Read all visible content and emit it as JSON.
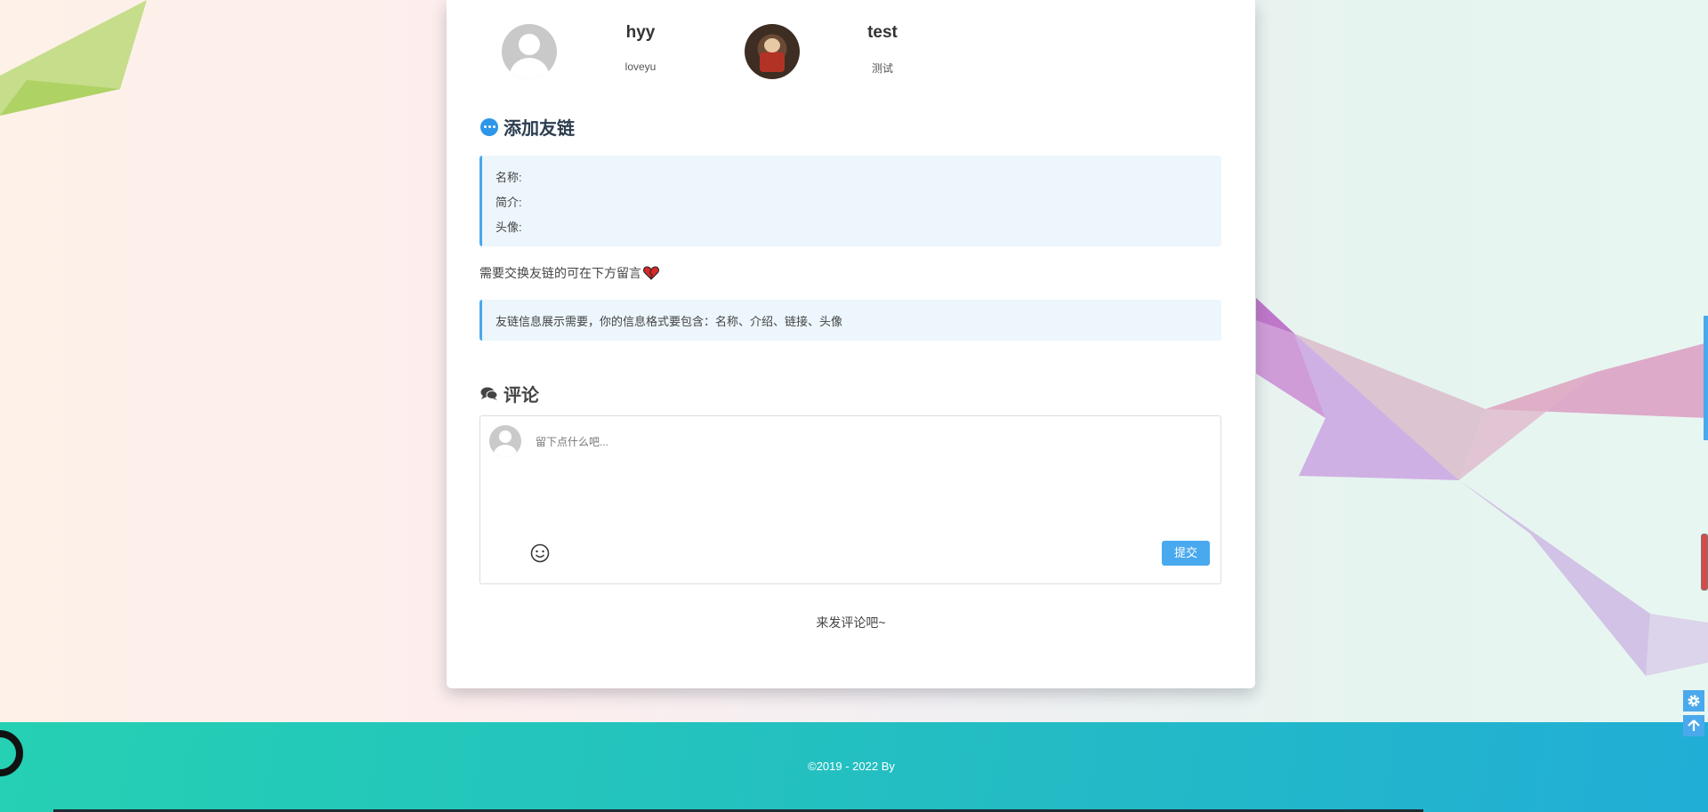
{
  "friends": [
    {
      "name": "hyy",
      "desc": "loveyu",
      "avatar": "default-avatar"
    },
    {
      "name": "test",
      "desc": "测试",
      "avatar": "photo-avatar"
    }
  ],
  "add_link": {
    "title": "添加友链",
    "fields": [
      "名称:",
      "简介:",
      "头像:"
    ],
    "notice": "需要交换友链的可在下方留言",
    "notice_icon": "broken-heart-icon",
    "tip": "友链信息展示需要，你的信息格式要包含：名称、介绍、链接、头像"
  },
  "comments": {
    "title": "评论",
    "placeholder": "留下点什么吧...",
    "submit_label": "提交",
    "empty_text": "来发评论吧~"
  },
  "footer": {
    "copyright": "©2019 - 2022 By"
  },
  "colors": {
    "accent": "#49a9ee",
    "footer_start": "#25d0b3",
    "footer_end": "#21aed6"
  },
  "side_tools": [
    "gear-icon",
    "arrow-up-icon"
  ]
}
